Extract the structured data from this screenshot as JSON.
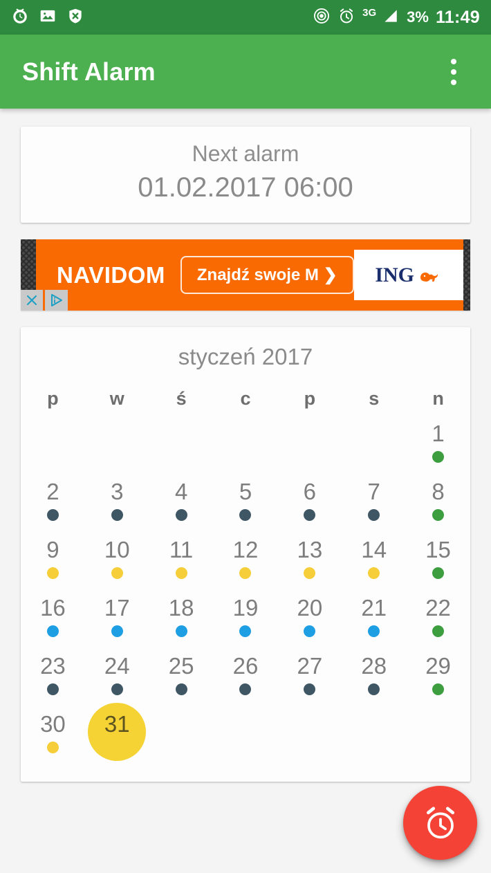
{
  "statusbar": {
    "left_icons": [
      "pomodoro-timer-icon",
      "image-icon",
      "shield-x-icon"
    ],
    "right_icons": [
      "hotspot-icon",
      "alarm-icon"
    ],
    "network": "3G",
    "battery": "3%",
    "time": "11:49"
  },
  "appbar": {
    "title": "Shift Alarm",
    "overflow_icon": "more-vert-icon"
  },
  "next_alarm": {
    "label": "Next alarm",
    "value": "01.02.2017 06:00"
  },
  "ad": {
    "brand": "NAVIDOM",
    "cta": "Znajdź swoje M ❯",
    "logo_text": "ING",
    "close_label": "✕",
    "adchoices_label": "ⓘ"
  },
  "calendar": {
    "title": "styczeń 2017",
    "weekdays": [
      "p",
      "w",
      "ś",
      "c",
      "p",
      "s",
      "n"
    ],
    "colors": {
      "dark": "#3f5765",
      "green": "#3d9e40",
      "yellow": "#f5ce3a",
      "blue": "#1e9ee3",
      "selected": "#f5d335"
    },
    "leading_blanks": 6,
    "days": [
      {
        "n": "1",
        "dot": "green"
      },
      {
        "n": "2",
        "dot": "dark"
      },
      {
        "n": "3",
        "dot": "dark"
      },
      {
        "n": "4",
        "dot": "dark"
      },
      {
        "n": "5",
        "dot": "dark"
      },
      {
        "n": "6",
        "dot": "dark"
      },
      {
        "n": "7",
        "dot": "dark"
      },
      {
        "n": "8",
        "dot": "green"
      },
      {
        "n": "9",
        "dot": "yellow"
      },
      {
        "n": "10",
        "dot": "yellow"
      },
      {
        "n": "11",
        "dot": "yellow"
      },
      {
        "n": "12",
        "dot": "yellow"
      },
      {
        "n": "13",
        "dot": "yellow"
      },
      {
        "n": "14",
        "dot": "yellow"
      },
      {
        "n": "15",
        "dot": "green"
      },
      {
        "n": "16",
        "dot": "blue"
      },
      {
        "n": "17",
        "dot": "blue"
      },
      {
        "n": "18",
        "dot": "blue"
      },
      {
        "n": "19",
        "dot": "blue"
      },
      {
        "n": "20",
        "dot": "blue"
      },
      {
        "n": "21",
        "dot": "blue"
      },
      {
        "n": "22",
        "dot": "green"
      },
      {
        "n": "23",
        "dot": "dark"
      },
      {
        "n": "24",
        "dot": "dark"
      },
      {
        "n": "25",
        "dot": "dark"
      },
      {
        "n": "26",
        "dot": "dark"
      },
      {
        "n": "27",
        "dot": "dark"
      },
      {
        "n": "28",
        "dot": "dark"
      },
      {
        "n": "29",
        "dot": "green"
      },
      {
        "n": "30",
        "dot": "yellow"
      },
      {
        "n": "31",
        "dot": null,
        "selected": true
      }
    ]
  },
  "fab": {
    "icon": "alarm-add-icon",
    "color": "#f44336"
  }
}
